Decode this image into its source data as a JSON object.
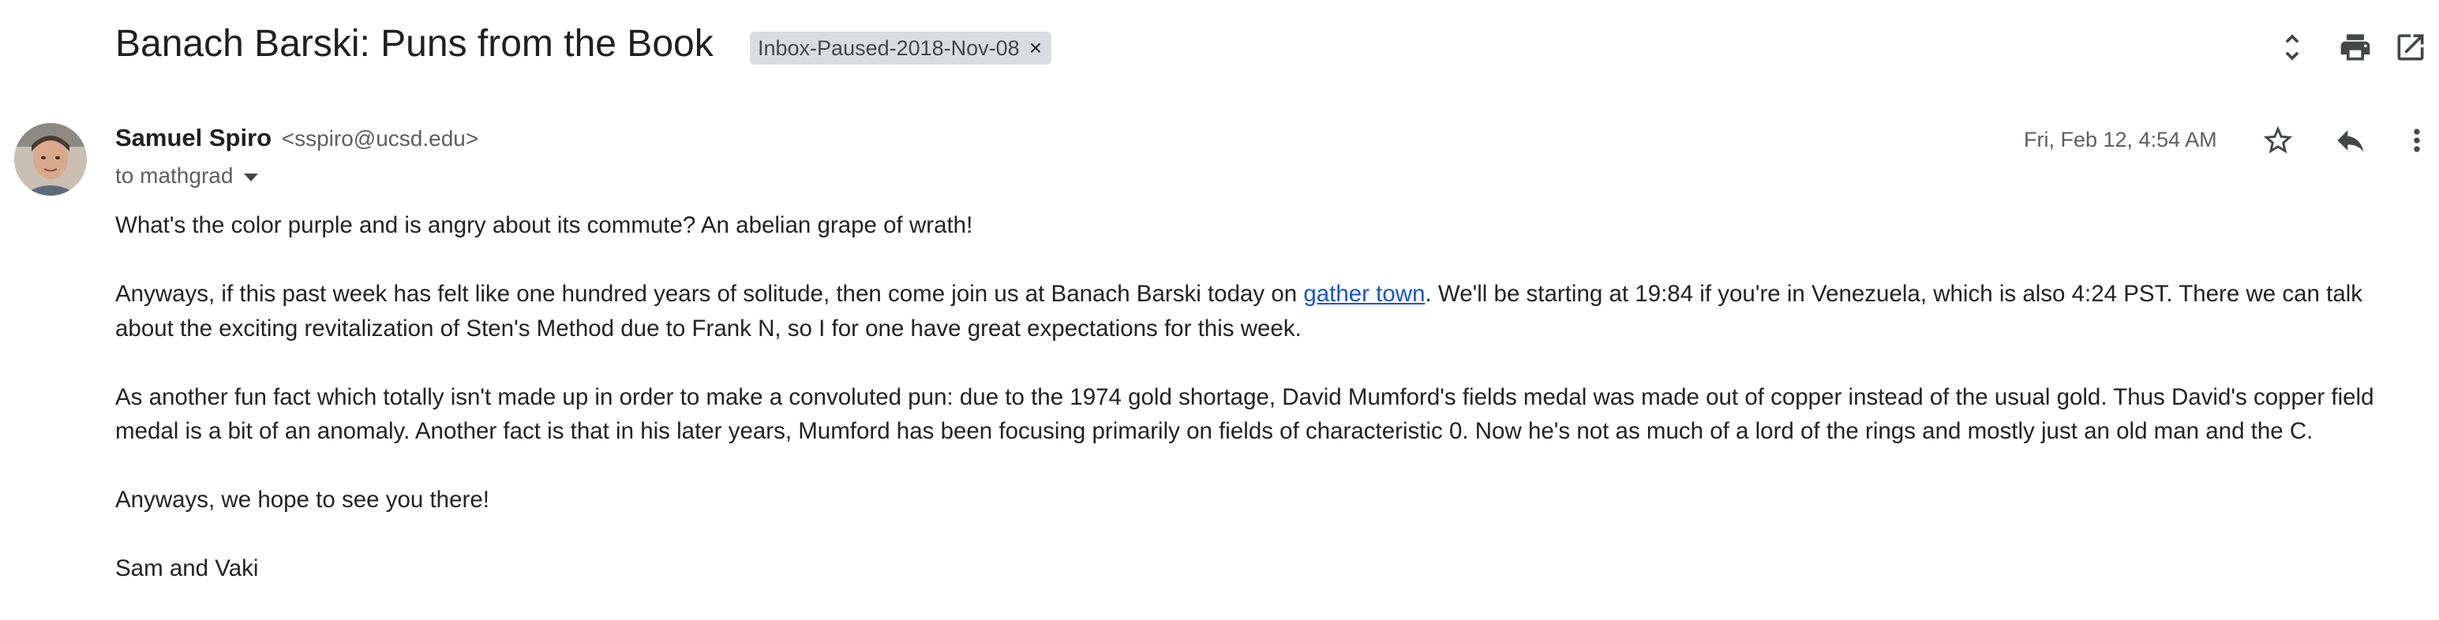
{
  "email": {
    "subject": "Banach Barski: Puns from the Book",
    "label": "Inbox-Paused-2018-Nov-08",
    "sender_name": "Samuel Spiro",
    "sender_email": "<sspiro@ucsd.edu>",
    "recipient_line": "to mathgrad",
    "date": "Fri, Feb 12, 4:54 AM",
    "body": {
      "p1": "What's the color purple and is angry about its commute?  An abelian grape of wrath!",
      "p2_before_link": "Anyways, if this past week has felt like one hundred years of solitude, then come join us at Banach Barski today on ",
      "p2_link": "gather town",
      "p2_after_link": ".  We'll be starting at 19:84 if you're in Venezuela, which is also 4:24 PST.  There we can talk about the exciting revitalization of Sten's Method due to Frank N, so I for one have great expectations for this week.",
      "p3": "As another fun fact which totally isn't made up in order to make a convoluted pun: due to the 1974 gold shortage, David Mumford's fields medal was made out of copper instead of the usual gold.  Thus David's copper field medal is a bit of an anomaly.  Another fact is that in his later years, Mumford has been focusing primarily on fields of characteristic 0.  Now he's not as much of a lord of the rings and mostly just an old man and the C.",
      "p4": "Anyways, we hope to see you there!",
      "signature": "Sam and Vaki"
    }
  },
  "icons": {
    "label_remove": "×",
    "expand_collapse": "unfold-icon",
    "print": "print-icon",
    "open_new_window": "open-in-new-icon",
    "star": "star-icon",
    "reply": "reply-icon",
    "more": "more-vert-icon"
  },
  "colors": {
    "link": "#1a56c9",
    "chip_bg": "#dadce0",
    "secondary_text": "#5e5e5e"
  }
}
